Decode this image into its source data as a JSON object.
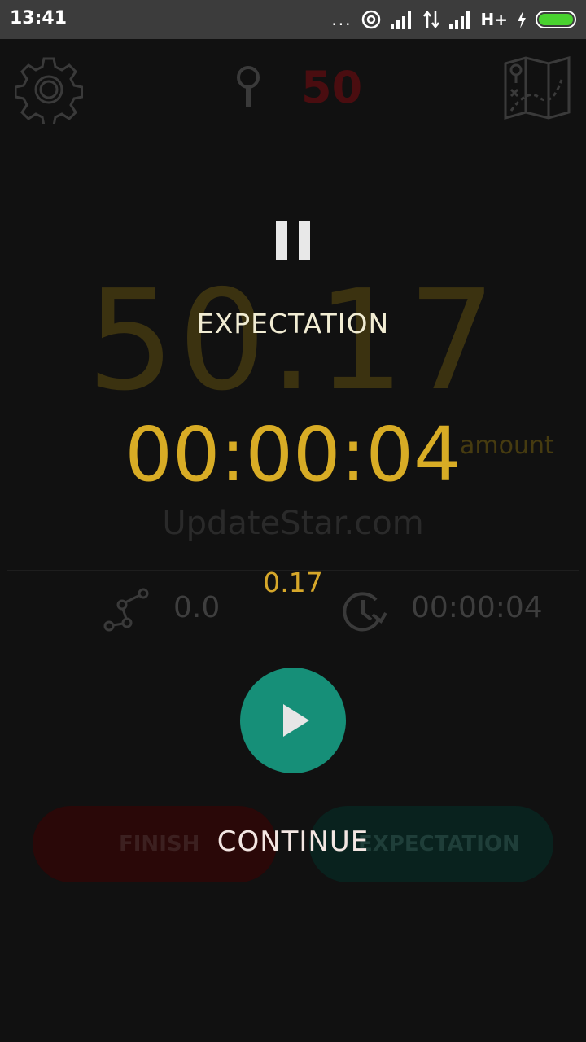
{
  "status_bar": {
    "time": "13:41",
    "dots": "...",
    "network": "H+",
    "battery_color": "#49d22f"
  },
  "app": {
    "top_count": "50",
    "big_number": "50.17",
    "amount_label": "amount",
    "watermark": "UpdateStar.com",
    "stats": {
      "distance": "0.0",
      "duration": "00:00:04"
    },
    "buttons": {
      "finish": "FINISH",
      "expectation": "EXPECTATION"
    },
    "icons": {
      "settings": "gear-icon",
      "pin": "map-pin-icon",
      "map": "map-icon",
      "route": "route-icon",
      "clock": "clock-icon"
    }
  },
  "overlay": {
    "status": "EXPECTATION",
    "timer": "00:00:04",
    "amount": "0.17",
    "action": "CONTINUE",
    "icons": {
      "pause": "pause-icon",
      "play": "play-icon"
    },
    "colors": {
      "accent": "#d8ac25",
      "play_button": "#168f78"
    }
  }
}
